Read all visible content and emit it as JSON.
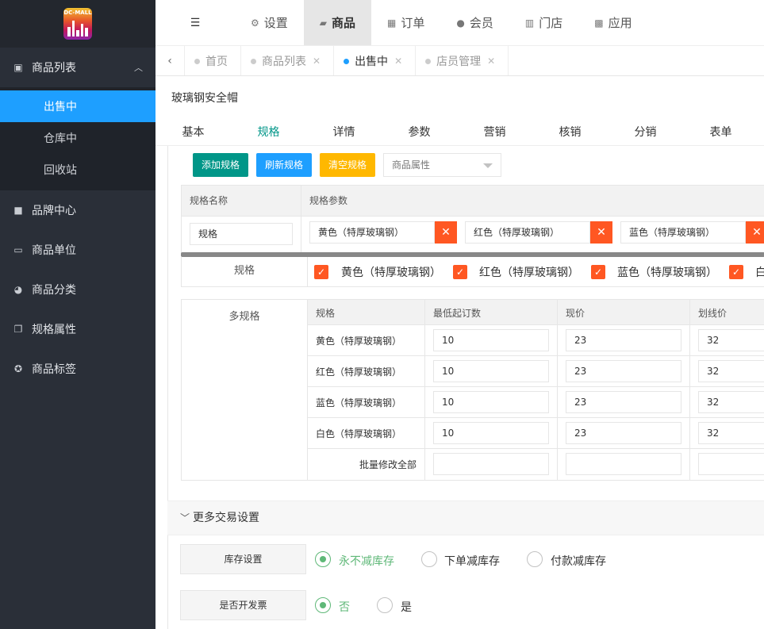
{
  "logo": {
    "text": "DC-MALL"
  },
  "sidebar": {
    "group": {
      "label": "商品列表",
      "icon": "box-icon"
    },
    "subitems": [
      {
        "label": "出售中",
        "active": true
      },
      {
        "label": "仓库中",
        "active": false
      },
      {
        "label": "回收站",
        "active": false
      }
    ],
    "items": [
      {
        "label": "品牌中心",
        "icon": "briefcase-icon"
      },
      {
        "label": "商品单位",
        "icon": "keyboard-icon"
      },
      {
        "label": "商品分类",
        "icon": "pie-icon"
      },
      {
        "label": "规格属性",
        "icon": "copy-icon"
      },
      {
        "label": "商品标签",
        "icon": "soccer-icon"
      }
    ]
  },
  "topnav": {
    "tabs": [
      {
        "label": "设置",
        "icon": "gears-icon"
      },
      {
        "label": "商品",
        "icon": "bag-icon"
      },
      {
        "label": "订单",
        "icon": "table-icon"
      },
      {
        "label": "会员",
        "icon": "user-icon"
      },
      {
        "label": "门店",
        "icon": "bank-icon"
      },
      {
        "label": "应用",
        "icon": "grid-icon"
      }
    ]
  },
  "pagetabs": [
    {
      "label": "首页"
    },
    {
      "label": "商品列表"
    },
    {
      "label": "出售中"
    },
    {
      "label": "店员管理"
    }
  ],
  "page": {
    "title": "玻璃钢安全帽"
  },
  "form_tabs": [
    "基本",
    "规格",
    "详情",
    "参数",
    "营销",
    "核销",
    "分销",
    "表单"
  ],
  "spec_buttons": {
    "add": "添加规格",
    "refresh": "刷新规格",
    "clear": "清空规格"
  },
  "attr_select": {
    "placeholder": "商品属性"
  },
  "spec_table": {
    "col_name": "规格名称",
    "col_params": "规格参数",
    "name_value": "规格",
    "params": [
      "黄色（特厚玻璃钢）",
      "红色（特厚玻璃钢）",
      "蓝色（特厚玻璃钢）"
    ]
  },
  "spec_check": {
    "label": "规格",
    "options": [
      "黄色（特厚玻璃钢）",
      "红色（特厚玻璃钢）",
      "蓝色（特厚玻璃钢）",
      "白"
    ]
  },
  "multi": {
    "label": "多规格",
    "headers": [
      "规格",
      "最低起订数",
      "现价",
      "划线价"
    ],
    "rows": [
      {
        "name": "黄色（特厚玻璃钢）",
        "min": "10",
        "price": "23",
        "orig": "32"
      },
      {
        "name": "红色（特厚玻璃钢）",
        "min": "10",
        "price": "23",
        "orig": "32"
      },
      {
        "name": "蓝色（特厚玻璃钢）",
        "min": "10",
        "price": "23",
        "orig": "32"
      },
      {
        "name": "白色（特厚玻璃钢）",
        "min": "10",
        "price": "23",
        "orig": "32"
      }
    ],
    "batch_label": "批量修改全部"
  },
  "more": {
    "label": "更多交易设置"
  },
  "stock": {
    "label": "库存设置",
    "options": [
      "永不减库存",
      "下单减库存",
      "付款减库存"
    ],
    "selected": 0
  },
  "invoice": {
    "label": "是否开发票",
    "options": [
      "否",
      "是"
    ],
    "selected": 0
  },
  "colors": {
    "accent": "#009688",
    "active_blue": "#1e9fff",
    "orange": "#ff5722",
    "yellow": "#ffb800",
    "green_radio": "#5fb878"
  }
}
